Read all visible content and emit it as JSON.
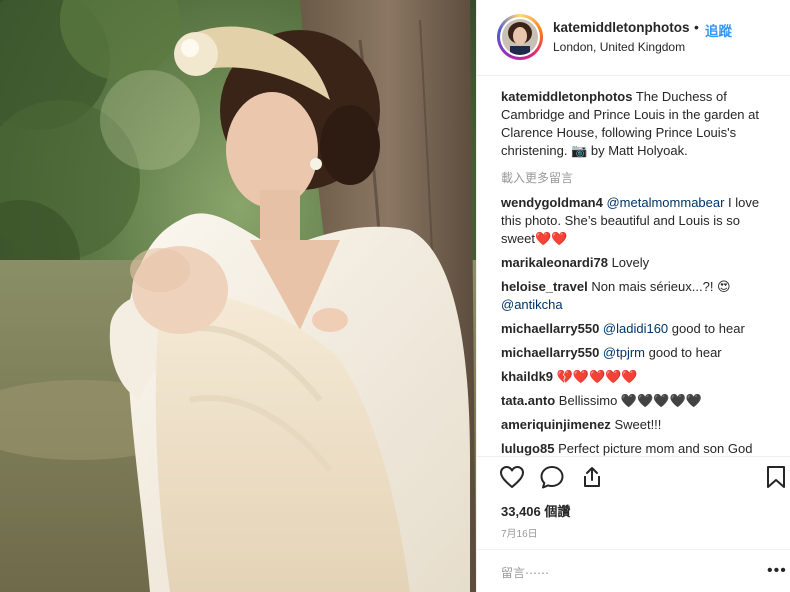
{
  "post": {
    "photo_alt": "Photo of a woman in a cream dress and headband holding a baby in a christening gown in a garden",
    "header": {
      "username": "katemiddletonphotos",
      "separator": "•",
      "follow_label": "追蹤",
      "location": "London, United Kingdom"
    },
    "caption": {
      "username": "katemiddletonphotos",
      "text": "The Duchess of Cambridge and Prince Louis in the garden at Clarence House, following Prince Louis's christening. 📷 by Matt Holyoak."
    },
    "load_more_label": "載入更多留言",
    "comments": [
      {
        "username": "wendygoldman4",
        "mention": "@metalmommabear",
        "text": " I love this photo. She’s beautiful and Louis is so sweet❤️❤️"
      },
      {
        "username": "marikaleonardi78",
        "mention": "",
        "text": "Lovely"
      },
      {
        "username": "heloise_travel",
        "mention": "",
        "text": "Non mais sérieux...?! 😍 ",
        "mention_after": "@antikcha"
      },
      {
        "username": "michaellarry550",
        "mention": "@ladidi160",
        "text": " good to hear"
      },
      {
        "username": "michaellarry550",
        "mention": "@tpjrm",
        "text": " good to hear"
      },
      {
        "username": "khaildk9",
        "mention": "",
        "text": "💔❤️❤️❤️❤️"
      },
      {
        "username": "tata.anto",
        "mention": "",
        "text": "Bellissimo 🖤🖤🖤🖤🖤"
      },
      {
        "username": "ameriquinjimenez",
        "mention": "",
        "text": "Sweet!!!"
      },
      {
        "username": "lulugo85",
        "mention": "",
        "text": "Perfect picture mom and son God"
      }
    ],
    "actions": {
      "like_icon": "heart-outline-icon",
      "comment_icon": "speech-bubble-icon",
      "share_icon": "share-upload-icon",
      "save_icon": "bookmark-icon"
    },
    "likes_text": "33,406 個讚",
    "date_text": "7月16日",
    "add_comment_placeholder": "留言⋯⋯",
    "more_options_label": "•••"
  },
  "colors": {
    "link_blue": "#3897f0",
    "mention_blue": "#003569",
    "muted": "#999999",
    "text": "#262626",
    "border": "#efefef"
  }
}
